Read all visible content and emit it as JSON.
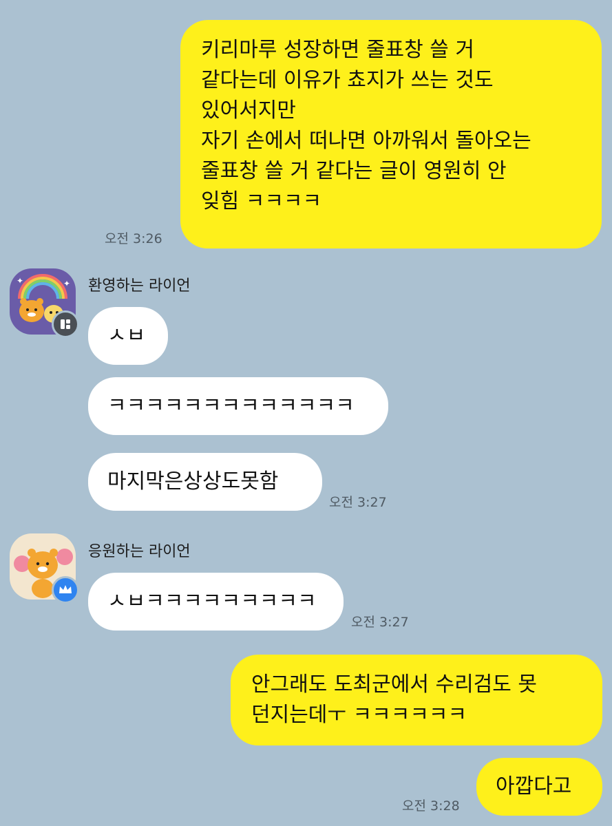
{
  "colors": {
    "background": "#abc1d1",
    "my_bubble": "#fef01b",
    "other_bubble": "#ffffff",
    "timestamp": "#4f5a63"
  },
  "messages": {
    "m1": {
      "lines": [
        "키리마루 성장하면 줄표창 쓸 거",
        "같다는데 이유가 쵸지가 쓰는 것도",
        "있어서지만",
        "자기 손에서 떠나면 아까워서 돌아오는",
        "줄표창 쓸 거 같다는 글이 영원히 안",
        "잊힘 ㅋㅋㅋㅋ"
      ],
      "time": "오전 3:26"
    },
    "group1": {
      "sender": "환영하는 라이언",
      "avatar_icon": "ryan-rainbow-avatar-icon",
      "badge_icon": "openchat-host-badge-icon",
      "bubbles": [
        "ㅅㅂ",
        "ㅋㅋㅋㅋㅋㅋㅋㅋㅋㅋㅋㅋㅋ",
        "마지막은상상도못함"
      ],
      "time": "오전 3:27"
    },
    "group2": {
      "sender": "응원하는 라이언",
      "avatar_icon": "ryan-cheering-avatar-icon",
      "badge_icon": "crown-badge-icon",
      "bubbles": [
        "ㅅㅂㅋㅋㅋㅋㅋㅋㅋㅋㅋ"
      ],
      "time": "오전 3:27"
    },
    "m2": {
      "lines": [
        "안그래도 도최군에서 수리검도 못",
        "던지는데ㅜ ㅋㅋㅋㅋㅋㅋ"
      ]
    },
    "m3": {
      "text": "아깝다고",
      "time": "오전 3:28"
    }
  }
}
